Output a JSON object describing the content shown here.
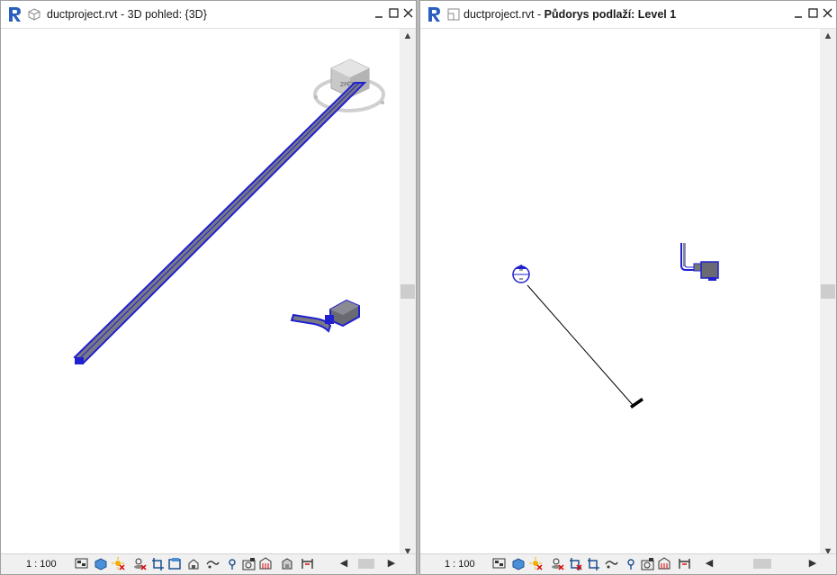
{
  "left_window": {
    "title": "ductproject.rvt - 3D pohled: {3D}",
    "scale": "1 : 100",
    "viewcube_label": "ZPĚT"
  },
  "right_window": {
    "title_prefix": "ductproject.rvt - ",
    "title_bold": "Půdorys podlaží: Level 1",
    "scale": "1 : 100"
  },
  "window_buttons": [
    "minimize",
    "maximize",
    "close"
  ],
  "colors": {
    "duct_blue": "#2020d0",
    "duct_gray": "#707078",
    "revit_blue": "#2a5fbf"
  },
  "status_icons": [
    "detail-level-icon",
    "visual-style-icon",
    "sun-path-icon",
    "shadows-icon",
    "crop-view-icon",
    "show-crop-icon",
    "unlock-3d-icon",
    "temporary-hide-icon",
    "reveal-hidden-icon",
    "render-icon",
    "analytical-model-icon",
    "highlight-displacement-icon",
    "reveal-constraints-icon"
  ]
}
